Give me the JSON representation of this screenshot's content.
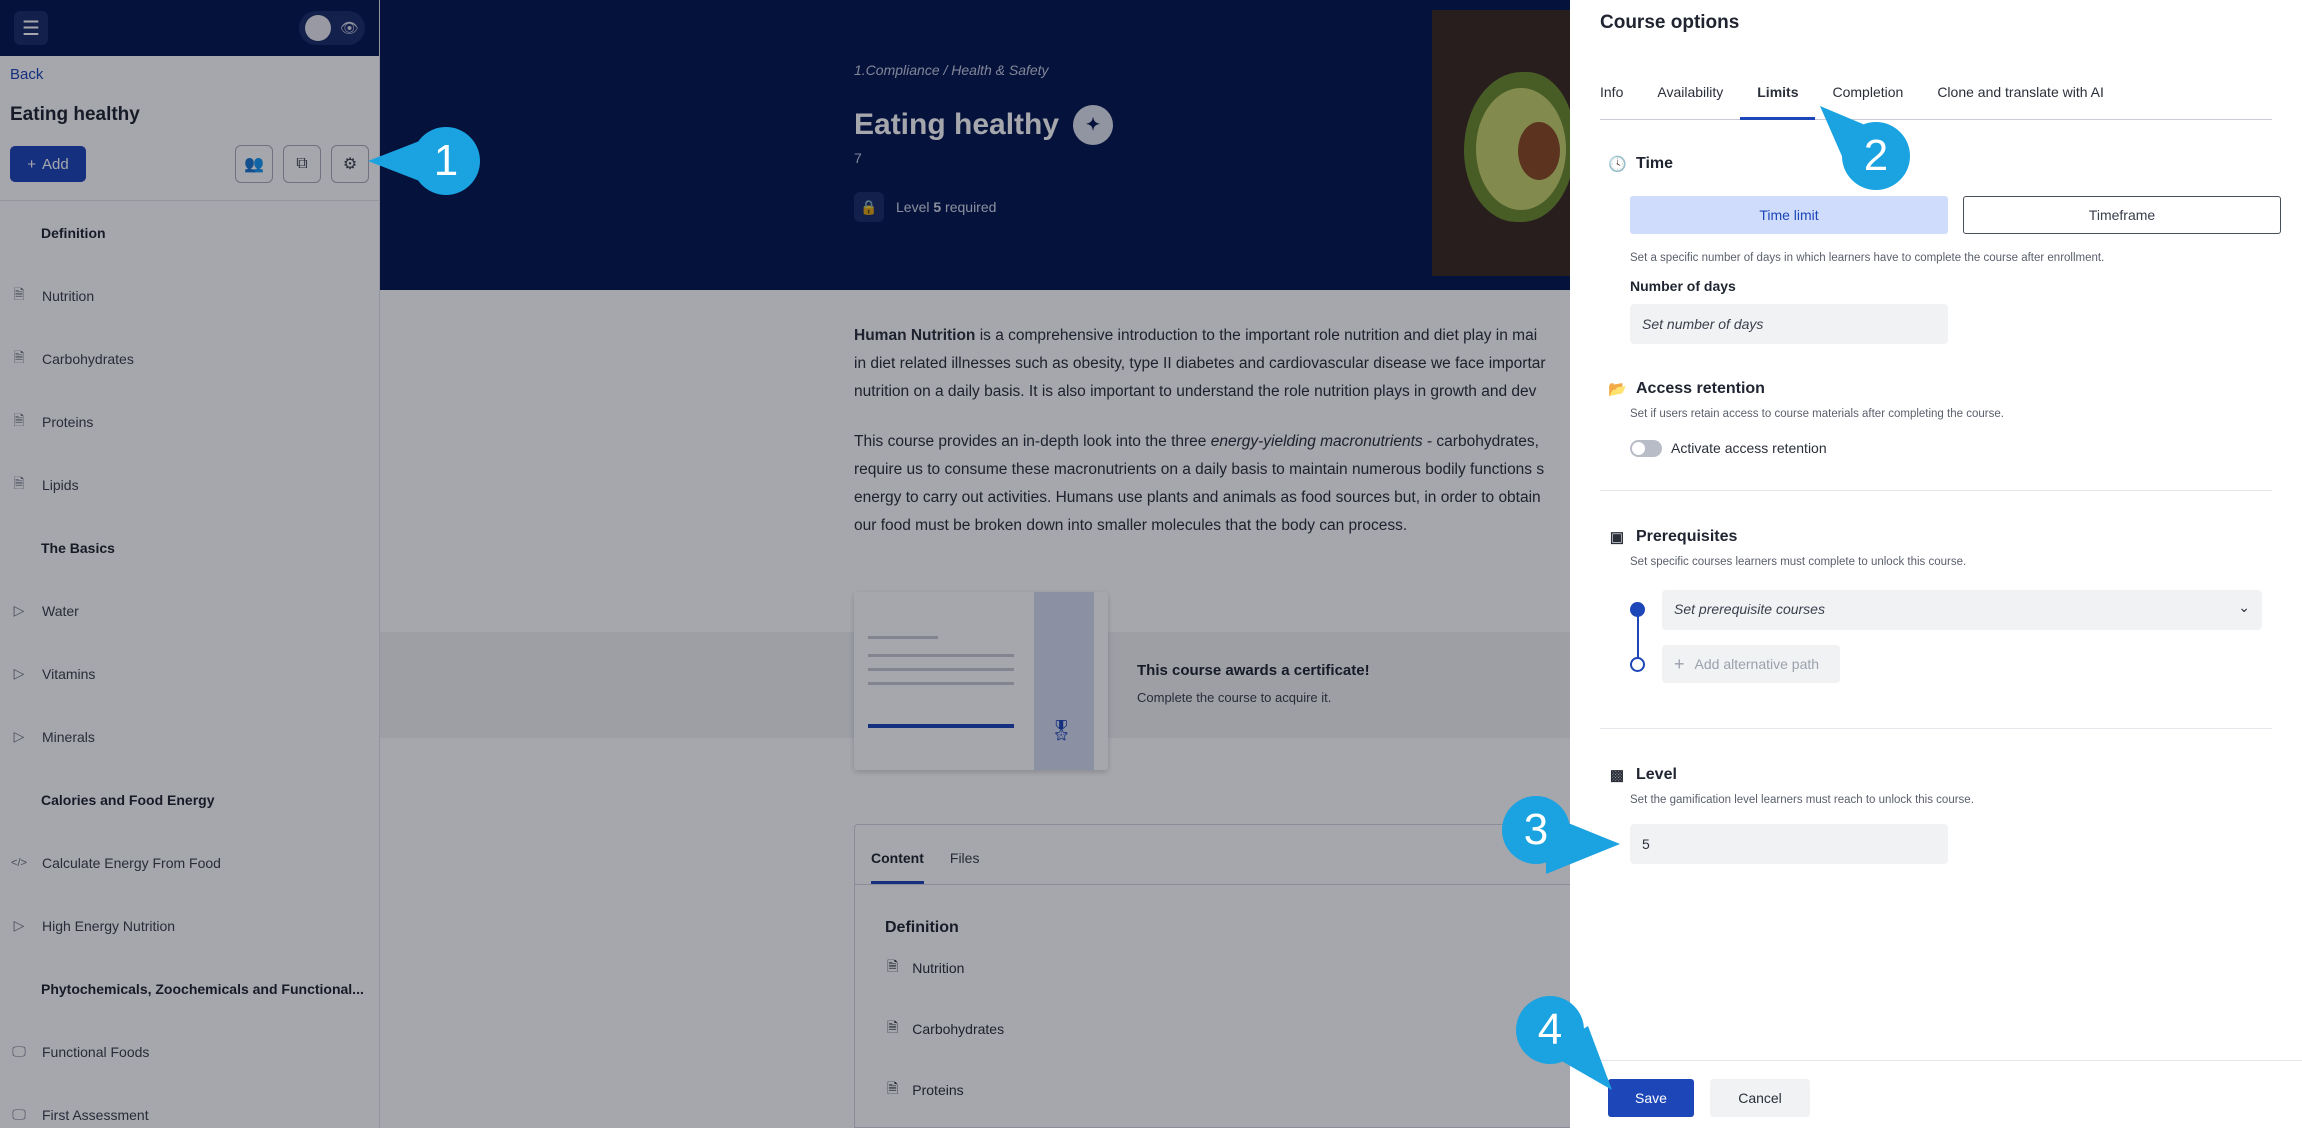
{
  "sidebar": {
    "back": "Back",
    "course_title": "Eating healthy",
    "add_label": "Add",
    "items": [
      {
        "label": "Definition",
        "type": "section",
        "icon": ""
      },
      {
        "label": "Nutrition",
        "type": "doc",
        "icon": "document-icon"
      },
      {
        "label": "Carbohydrates",
        "type": "doc",
        "icon": "document-icon"
      },
      {
        "label": "Proteins",
        "type": "doc",
        "icon": "document-icon"
      },
      {
        "label": "Lipids",
        "type": "doc",
        "icon": "document-icon"
      },
      {
        "label": "The Basics",
        "type": "section",
        "icon": ""
      },
      {
        "label": "Water",
        "type": "video",
        "icon": "play-icon"
      },
      {
        "label": "Vitamins",
        "type": "video",
        "icon": "play-icon"
      },
      {
        "label": "Minerals",
        "type": "video",
        "icon": "play-icon"
      },
      {
        "label": "Calories and Food Energy",
        "type": "section",
        "icon": ""
      },
      {
        "label": "Calculate Energy From Food",
        "type": "code",
        "icon": "code-icon"
      },
      {
        "label": "High Energy Nutrition",
        "type": "video",
        "icon": "play-icon"
      },
      {
        "label": "Phytochemicals, Zoochemicals and Functional...",
        "type": "section",
        "icon": ""
      },
      {
        "label": "Functional Foods",
        "type": "screen",
        "icon": "monitor-icon"
      },
      {
        "label": "First Assessment",
        "type": "screen",
        "icon": "monitor-icon"
      }
    ]
  },
  "hero": {
    "breadcrumb": "1.Compliance / Health & Safety",
    "title": "Eating healthy",
    "number": "7",
    "level_prefix": "Level ",
    "level_value": "5",
    "level_suffix": " required"
  },
  "description": {
    "p1_bold": "Human Nutrition",
    "p1_rest": " is a comprehensive introduction to the important role nutrition and diet play in mai",
    "p1_line2": "in diet related illnesses such as obesity, type II diabetes and cardiovascular disease we face importar",
    "p1_line3": "nutrition on a daily basis. It is also important to understand the role nutrition plays in growth and dev",
    "p2_line1_a": "This course provides an in-depth look into the three ",
    "p2_line1_em": "energy-yielding macronutrients",
    "p2_line1_b": " - carbohydrates,",
    "p2_line2": "require us to consume these macronutrients on a daily basis to maintain numerous bodily functions s",
    "p2_line3": "energy to carry out activities. Humans use plants and animals as food sources but, in order to obtain",
    "p2_line4": "our food must be broken down into smaller molecules that the body can process."
  },
  "certificate": {
    "title": "This course awards a certificate!",
    "subtitle": "Complete the course to acquire it."
  },
  "content_tabs": {
    "tabs": [
      "Content",
      "Files"
    ],
    "section": "Definition",
    "items": [
      "Nutrition",
      "Carbohydrates",
      "Proteins"
    ]
  },
  "panel": {
    "title": "Course options",
    "tabs": [
      "Info",
      "Availability",
      "Limits",
      "Completion",
      "Clone and translate with AI"
    ],
    "active_tab": "Limits",
    "time": {
      "heading": "Time",
      "option_on": "Time limit",
      "option_off": "Timeframe",
      "desc": "Set a specific number of days in which learners have to complete the course after enrollment.",
      "days_label": "Number of days",
      "days_placeholder": "Set number of days"
    },
    "access": {
      "heading": "Access retention",
      "desc": "Set if users retain access to course materials after completing the course.",
      "toggle_label": "Activate access retention"
    },
    "prereq": {
      "heading": "Prerequisites",
      "desc": "Set specific courses learners must complete to unlock this course.",
      "select_placeholder": "Set prerequisite courses",
      "alt_path": "Add alternative path"
    },
    "level": {
      "heading": "Level",
      "desc": "Set the gamification level learners must reach to unlock this course.",
      "value": "5"
    },
    "save": "Save",
    "cancel": "Cancel"
  },
  "callouts": [
    "1",
    "2",
    "3",
    "4"
  ],
  "colors": {
    "accent": "#1d46b8",
    "hero": "#04164f",
    "callout": "#1aa3e0"
  }
}
